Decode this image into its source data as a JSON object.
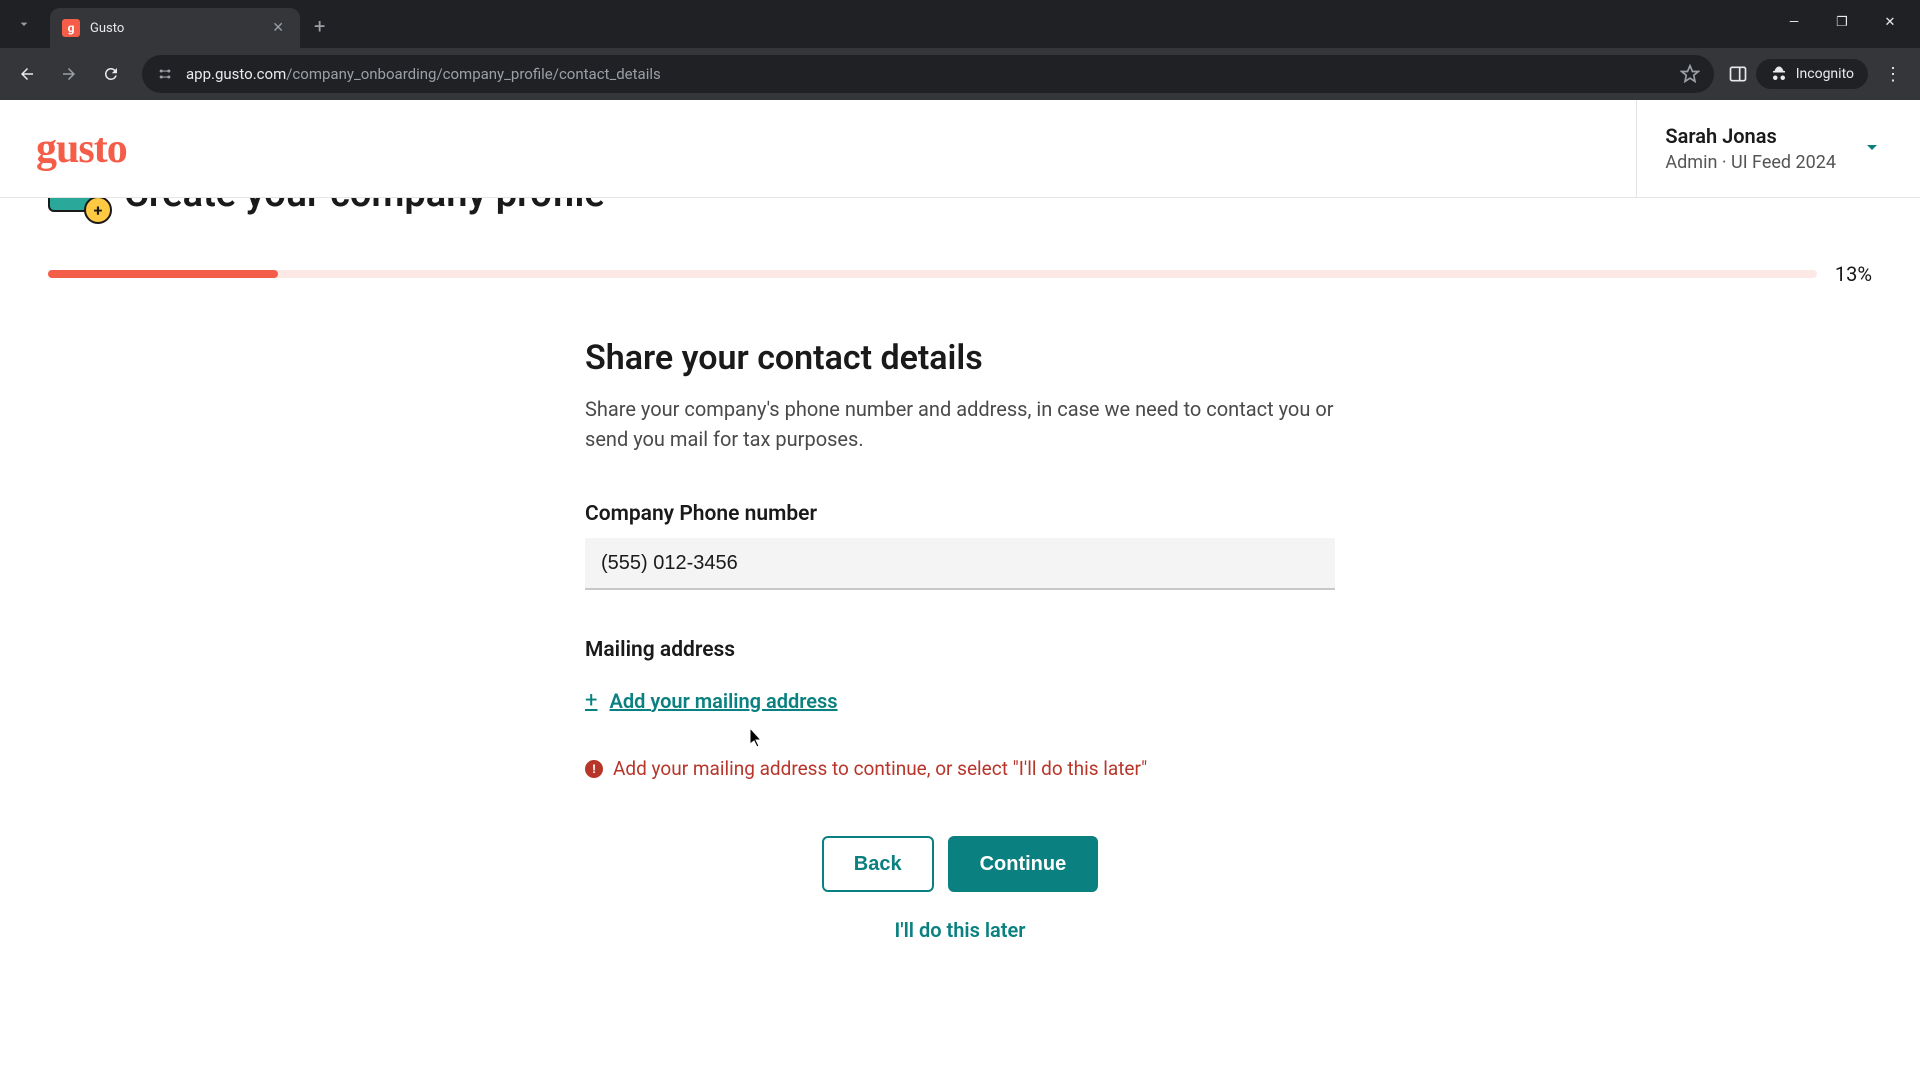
{
  "browser": {
    "tab_title": "Gusto",
    "favicon_letter": "g",
    "url_domain": "app.gusto.com",
    "url_path": "/company_onboarding/company_profile/contact_details",
    "incognito_label": "Incognito"
  },
  "header": {
    "logo": "gusto",
    "user_name": "Sarah Jonas",
    "user_role": "Admin · UI Feed 2024"
  },
  "page": {
    "title": "Create your company profile",
    "progress_percent": "13%",
    "section_heading": "Share your contact details",
    "section_desc": "Share your company's phone number and address, in case we need to contact you or send you mail for tax purposes.",
    "phone_label": "Company Phone number",
    "phone_value": "(555) 012-3456",
    "mailing_label": "Mailing address",
    "add_mailing_link": "Add your mailing address",
    "error_message": "Add your mailing address to continue, or select \"I'll do this later\"",
    "back_button": "Back",
    "continue_button": "Continue",
    "later_link": "I'll do this later"
  },
  "colors": {
    "brand": "#f45d48",
    "accent": "#0a8080",
    "error": "#b8352a"
  }
}
